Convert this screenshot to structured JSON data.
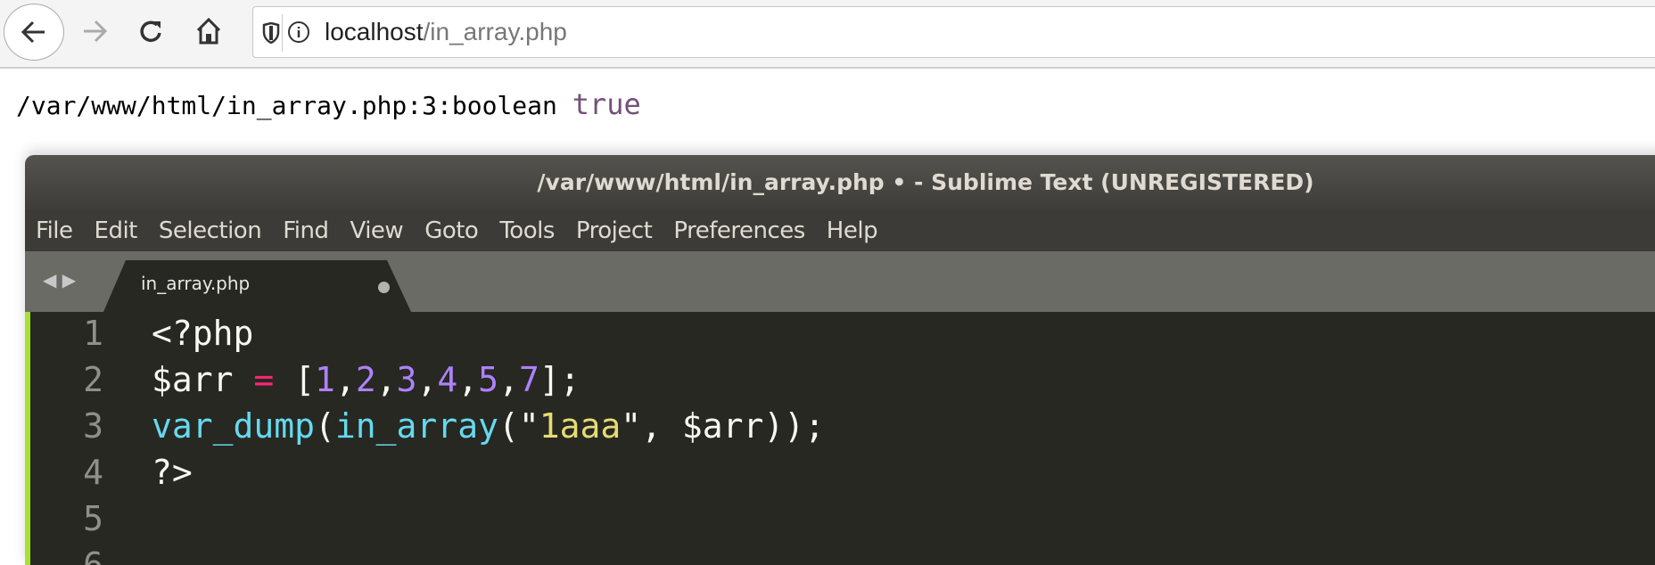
{
  "browser": {
    "url_host": "localhost",
    "url_path": "/in_array.php",
    "icons": [
      "back-arrow-icon",
      "forward-arrow-icon",
      "reload-icon",
      "home-icon",
      "shield-icon",
      "info-icon"
    ]
  },
  "page": {
    "output_prefix": "/var/www/html/in_array.php:3:boolean",
    "output_value": "true",
    "value_color": "#75507b"
  },
  "editor": {
    "title": "/var/www/html/in_array.php • - Sublime Text (UNREGISTERED)",
    "menu": [
      "File",
      "Edit",
      "Selection",
      "Find",
      "View",
      "Goto",
      "Tools",
      "Project",
      "Preferences",
      "Help"
    ],
    "tab": {
      "name": "in_array.php",
      "modified": true
    },
    "colors": {
      "background": "#272822",
      "keyword": "#f92672",
      "number": "#ae81ff",
      "function": "#66d9ef",
      "string": "#e6db74",
      "text": "#f8f8f2"
    },
    "lines": [
      {
        "n": "1",
        "tokens": [
          {
            "t": "<?php",
            "c": "text"
          }
        ]
      },
      {
        "n": "2",
        "tokens": [
          {
            "t": "$arr ",
            "c": "text"
          },
          {
            "t": "=",
            "c": "keyword"
          },
          {
            "t": " [",
            "c": "text"
          },
          {
            "t": "1",
            "c": "number"
          },
          {
            "t": ",",
            "c": "text"
          },
          {
            "t": "2",
            "c": "number"
          },
          {
            "t": ",",
            "c": "text"
          },
          {
            "t": "3",
            "c": "number"
          },
          {
            "t": ",",
            "c": "text"
          },
          {
            "t": "4",
            "c": "number"
          },
          {
            "t": ",",
            "c": "text"
          },
          {
            "t": "5",
            "c": "number"
          },
          {
            "t": ",",
            "c": "text"
          },
          {
            "t": "7",
            "c": "number"
          },
          {
            "t": "];",
            "c": "text"
          }
        ]
      },
      {
        "n": "3",
        "tokens": [
          {
            "t": "var_dump",
            "c": "function"
          },
          {
            "t": "(",
            "c": "text"
          },
          {
            "t": "in_array",
            "c": "function"
          },
          {
            "t": "(\"",
            "c": "text"
          },
          {
            "t": "1aaa",
            "c": "string"
          },
          {
            "t": "\", $arr));",
            "c": "text"
          }
        ]
      },
      {
        "n": "4",
        "tokens": [
          {
            "t": "?>",
            "c": "text"
          }
        ]
      },
      {
        "n": "5",
        "tokens": []
      },
      {
        "n": "6",
        "tokens": []
      }
    ]
  }
}
